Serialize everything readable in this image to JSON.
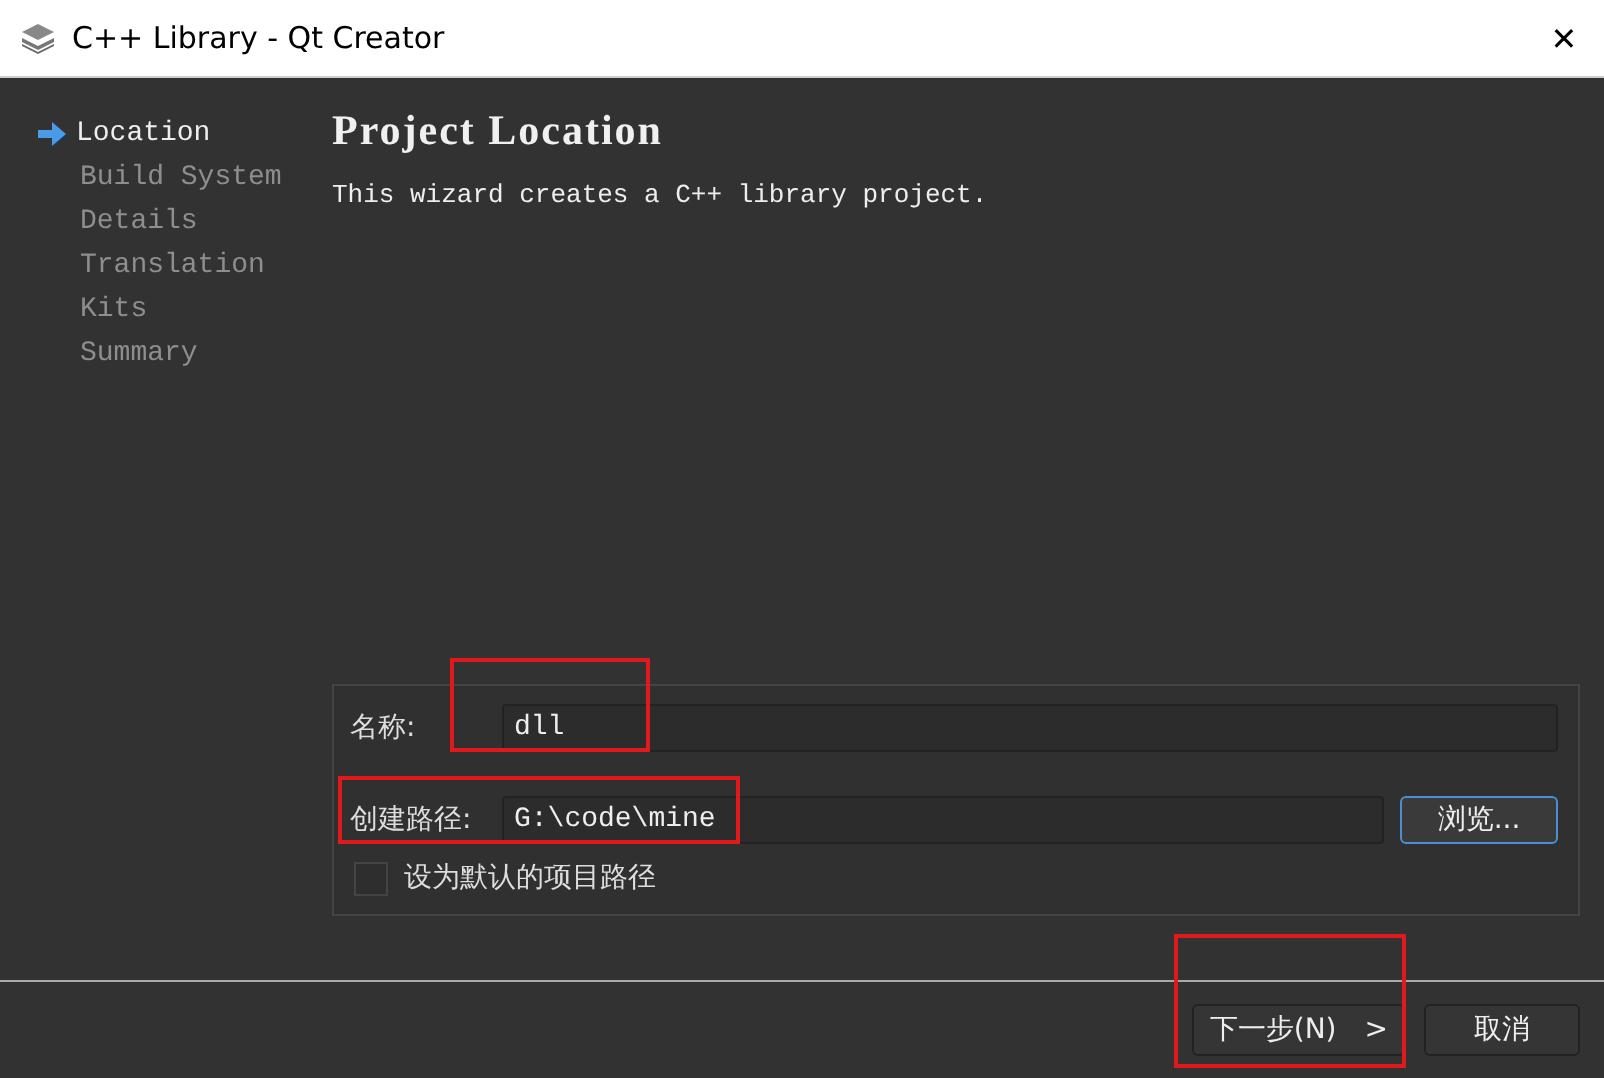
{
  "window": {
    "title": "C++ Library - Qt Creator",
    "close": "✕"
  },
  "steps": [
    {
      "label": "Location",
      "selected": true
    },
    {
      "label": "Build System",
      "selected": false
    },
    {
      "label": "Details",
      "selected": false
    },
    {
      "label": "Translation",
      "selected": false
    },
    {
      "label": "Kits",
      "selected": false
    },
    {
      "label": "Summary",
      "selected": false
    }
  ],
  "page": {
    "title": "Project Location",
    "description": "This wizard creates a C++ library project."
  },
  "form": {
    "name_label": "名称:",
    "name_value": "dll",
    "path_label": "创建路径:",
    "path_value": "G:\\code\\mine",
    "browse": "浏览...",
    "default_checkbox": {
      "label": "设为默认的项目路径",
      "checked": false
    }
  },
  "buttons": {
    "next": "下一步(N)",
    "next_arrow": ">",
    "cancel": "取消"
  }
}
